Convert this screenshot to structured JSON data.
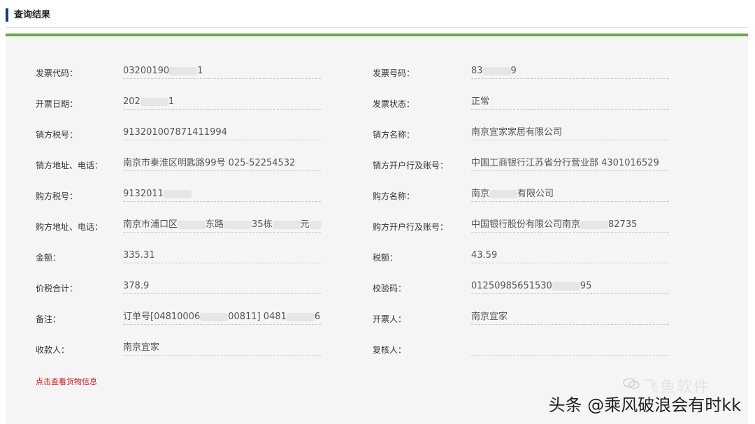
{
  "header": {
    "title": "查询结果"
  },
  "left_rows": [
    {
      "label": "发票代码：",
      "value": "03200190[REDACTED]1"
    },
    {
      "label": "开票日期：",
      "value": "202[REDACTED]1"
    },
    {
      "label": "销方税号：",
      "value": "913201007871411994"
    },
    {
      "label": "销方地址、电话：",
      "value": "南京市秦淮区明匙路99号 025-52254532"
    },
    {
      "label": "购方税号：",
      "value": "9132011[REDACTED]"
    },
    {
      "label": "购方地址、电话：",
      "value": "南京市浦口区[REDACTED]东路[REDACTED]35栋[REDACTED]元[REDACTED]15"
    },
    {
      "label": "金额：",
      "value": "335.31"
    },
    {
      "label": "价税合计：",
      "value": "378.9"
    },
    {
      "label": "备注：",
      "value": "订单号[04810006[REDACTED]00811] 0481[REDACTED]602"
    },
    {
      "label": "收款人：",
      "value": "南京宜家"
    }
  ],
  "right_rows": [
    {
      "label": "发票号码：",
      "value": "83[REDACTED]9"
    },
    {
      "label": "发票状态：",
      "value": "正常"
    },
    {
      "label": "销方名称：",
      "value": "南京宜家家居有限公司"
    },
    {
      "label": "销方开户行及账号：",
      "value": "中国工商银行江苏省分行营业部 4301016529"
    },
    {
      "label": "购方名称：",
      "value": "南京[REDACTED]有限公司"
    },
    {
      "label": "购方开户行及账号：",
      "value": "中国银行股份有限公司南京[REDACTED]82735"
    },
    {
      "label": "税额：",
      "value": "43.59"
    },
    {
      "label": "校验码：",
      "value": "01250985651530[REDACTED]95"
    },
    {
      "label": "开票人：",
      "value": "南京宜家"
    },
    {
      "label": "复核人：",
      "value": ""
    }
  ],
  "goods_link": "点击查看货物信息",
  "watermark": {
    "light_text": "飞鱼软件",
    "main_text": "头条 @乘风破浪会有时kk"
  },
  "colors": {
    "accent_green": "#6aa84f",
    "header_bar": "#1f3a6e",
    "link_red": "#d11a1a"
  }
}
